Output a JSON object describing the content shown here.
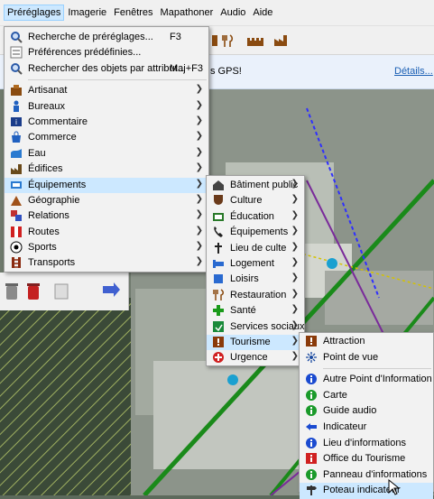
{
  "menubar": {
    "items": [
      "Préréglages",
      "Imagerie",
      "Fenêtres",
      "Mapathoner",
      "Audio",
      "Aide"
    ]
  },
  "infobar": {
    "message": "s GPS!",
    "link": "Détails..."
  },
  "presets_menu": {
    "top_items": [
      {
        "label": "Recherche de préréglages...",
        "shortcut": "F3",
        "icon": "search-icon"
      },
      {
        "label": "Préférences prédéfinies...",
        "shortcut": "",
        "icon": "preferences-icon"
      },
      {
        "label": "Rechercher des objets par attribut...",
        "shortcut": "Maj+F3",
        "icon": "search-icon"
      }
    ],
    "categories": [
      {
        "label": "Artisanat",
        "icon": "craft-icon"
      },
      {
        "label": "Bureaux",
        "icon": "office-icon"
      },
      {
        "label": "Commentaire",
        "icon": "comment-icon"
      },
      {
        "label": "Commerce",
        "icon": "shop-icon"
      },
      {
        "label": "Eau",
        "icon": "water-icon"
      },
      {
        "label": "Édifices",
        "icon": "building-icon"
      },
      {
        "label": "Équipements",
        "icon": "facilities-icon"
      },
      {
        "label": "Géographie",
        "icon": "geography-icon"
      },
      {
        "label": "Relations",
        "icon": "relations-icon"
      },
      {
        "label": "Routes",
        "icon": "roads-icon"
      },
      {
        "label": "Sports",
        "icon": "sports-icon"
      },
      {
        "label": "Transports",
        "icon": "transport-icon"
      }
    ]
  },
  "facilities_menu": {
    "items": [
      {
        "label": "Bâtiment public",
        "icon": "public-building-icon"
      },
      {
        "label": "Culture",
        "icon": "culture-icon"
      },
      {
        "label": "Éducation",
        "icon": "education-icon"
      },
      {
        "label": "Équipements",
        "icon": "telephone-icon"
      },
      {
        "label": "Lieu de culte",
        "icon": "worship-icon"
      },
      {
        "label": "Logement",
        "icon": "accommodation-icon"
      },
      {
        "label": "Loisirs",
        "icon": "leisure-icon"
      },
      {
        "label": "Restauration",
        "icon": "restaurant-icon"
      },
      {
        "label": "Santé",
        "icon": "health-icon"
      },
      {
        "label": "Services sociaux",
        "icon": "social-services-icon"
      },
      {
        "label": "Tourisme",
        "icon": "tourism-icon"
      },
      {
        "label": "Urgence",
        "icon": "emergency-icon"
      }
    ]
  },
  "tourism_menu": {
    "items": [
      {
        "label": "Attraction",
        "icon": "attraction-icon"
      },
      {
        "label": "Point de vue",
        "icon": "viewpoint-icon"
      },
      {
        "label": "Autre Point d'Information",
        "icon": "info-icon"
      },
      {
        "label": "Carte",
        "icon": "map-board-icon"
      },
      {
        "label": "Guide audio",
        "icon": "audio-guide-icon"
      },
      {
        "label": "Indicateur",
        "icon": "indicator-icon"
      },
      {
        "label": "Lieu d'informations",
        "icon": "info-office-icon"
      },
      {
        "label": "Office du Tourisme",
        "icon": "tourist-office-icon"
      },
      {
        "label": "Panneau d'informations",
        "icon": "info-board-icon"
      },
      {
        "label": "Poteau indicateur",
        "icon": "guidepost-icon"
      }
    ]
  },
  "colors": {
    "highlight": "#cce8ff",
    "menu_bg": "#f2f2f2"
  }
}
